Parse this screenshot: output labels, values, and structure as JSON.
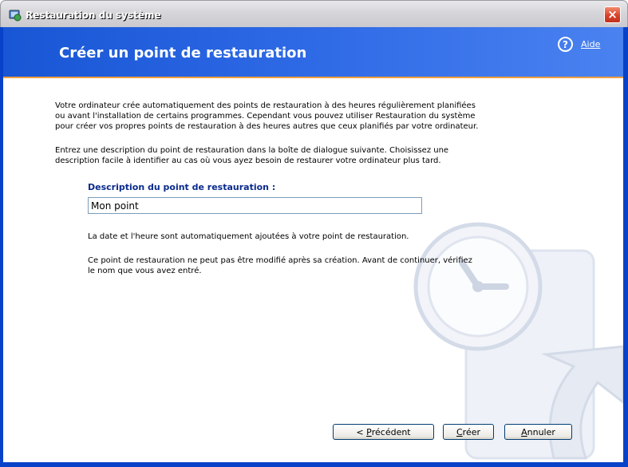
{
  "window": {
    "title": "Restauration du système",
    "close_glyph": "×"
  },
  "header": {
    "title": "Créer un point de restauration",
    "help_label": "Aide",
    "help_glyph": "?"
  },
  "content": {
    "intro_paragraph": "Votre ordinateur crée automatiquement des points de restauration à des heures régulièrement planifiées ou avant l'installation de certains programmes. Cependant vous pouvez utiliser Restauration du système pour créer vos propres points de restauration à des heures autres que ceux planifiés par votre ordinateur.",
    "instruction_paragraph": "Entrez une description du point de restauration dans la boîte de dialogue suivante. Choisissez une description facile à identifier au cas où vous ayez besoin de restaurer votre ordinateur plus tard.",
    "field_label": "Description du point de restauration :",
    "field_value": "Mon point",
    "note_date": "La date et l'heure sont automatiquement ajoutées à votre point de restauration.",
    "note_warning": "Ce point de restauration ne peut pas être modifié après sa création. Avant de continuer, vérifiez le nom que vous avez entré."
  },
  "buttons": {
    "previous": {
      "prefix": "< ",
      "mnemonic": "P",
      "rest": "récédent"
    },
    "create": {
      "mnemonic": "C",
      "rest": "réer"
    },
    "cancel": {
      "mnemonic": "A",
      "rest": "nnuler"
    }
  },
  "colors": {
    "header_blue": "#2f6ae6",
    "frame_blue": "#0842c8",
    "label_blue": "#0a2a8c",
    "accent_orange": "#f0a040"
  }
}
